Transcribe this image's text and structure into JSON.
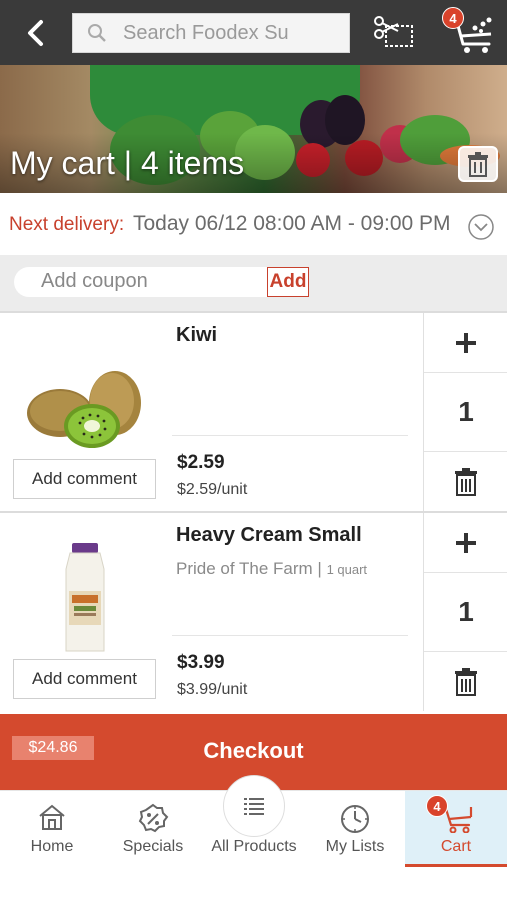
{
  "header": {
    "search_placeholder": "Search Foodex Su",
    "cart_count": "4"
  },
  "hero": {
    "title": "My cart | 4 items"
  },
  "delivery": {
    "label": "Next delivery:",
    "value": "Today 06/12 08:00 AM - 09:00 PM"
  },
  "coupon": {
    "placeholder": "Add coupon",
    "add_label": "Add"
  },
  "items": [
    {
      "name": "Kiwi",
      "brand": "",
      "size": "",
      "price": "$2.59",
      "unit_price": "$2.59/unit",
      "quantity": "1",
      "comment_label": "Add comment"
    },
    {
      "name": "Heavy Cream Small",
      "brand": "Pride of The Farm |",
      "size": "1 quart",
      "price": "$3.99",
      "unit_price": "$3.99/unit",
      "quantity": "1",
      "comment_label": "Add comment"
    }
  ],
  "checkout": {
    "total": "$24.86",
    "label": "Checkout"
  },
  "nav": {
    "home": "Home",
    "specials": "Specials",
    "all_products": "All Products",
    "my_lists": "My Lists",
    "cart": "Cart",
    "cart_count": "4"
  },
  "colors": {
    "accent": "#d44a2e",
    "topbar": "#3a3a3a"
  }
}
